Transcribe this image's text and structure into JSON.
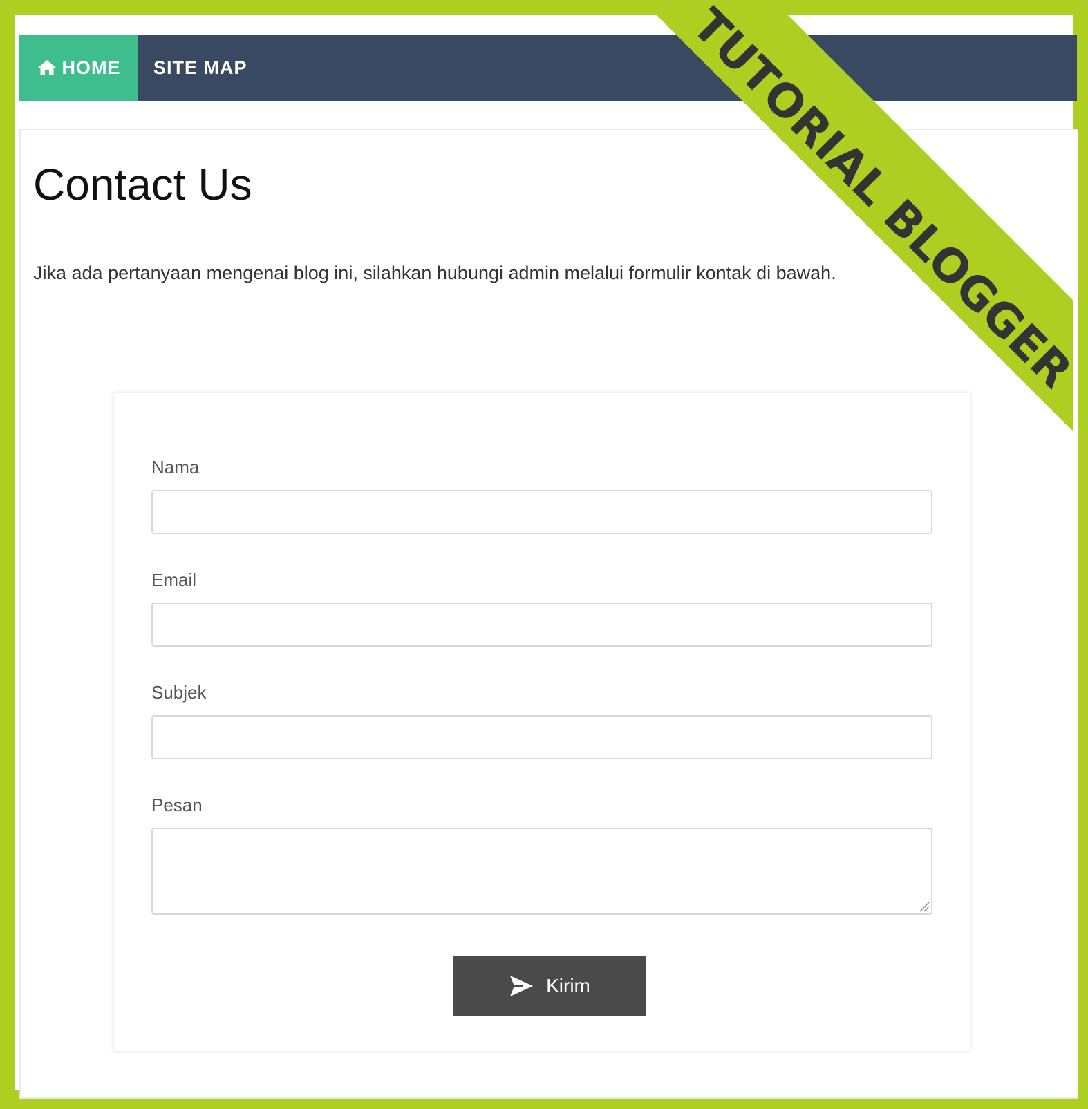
{
  "nav": {
    "home_label": "HOME",
    "sitemap_label": "SITE MAP"
  },
  "page": {
    "title": "Contact Us",
    "intro": "Jika ada pertanyaan mengenai blog ini, silahkan hubungi admin melalui formulir kontak di bawah."
  },
  "form": {
    "name_label": "Nama",
    "name_value": "",
    "email_label": "Email",
    "email_value": "",
    "subject_label": "Subjek",
    "subject_value": "",
    "message_label": "Pesan",
    "message_value": "",
    "submit_label": "Kirim"
  },
  "ribbon": {
    "text": "TUTORIAL BLOGGER"
  },
  "colors": {
    "frame": "#aecf22",
    "navbar": "#394961",
    "home_active": "#3ebd8f",
    "submit_button": "#4a4a4a"
  },
  "icons": {
    "home": "home-icon",
    "submit": "paper-plane-icon",
    "resize": "resize-grip-icon"
  }
}
